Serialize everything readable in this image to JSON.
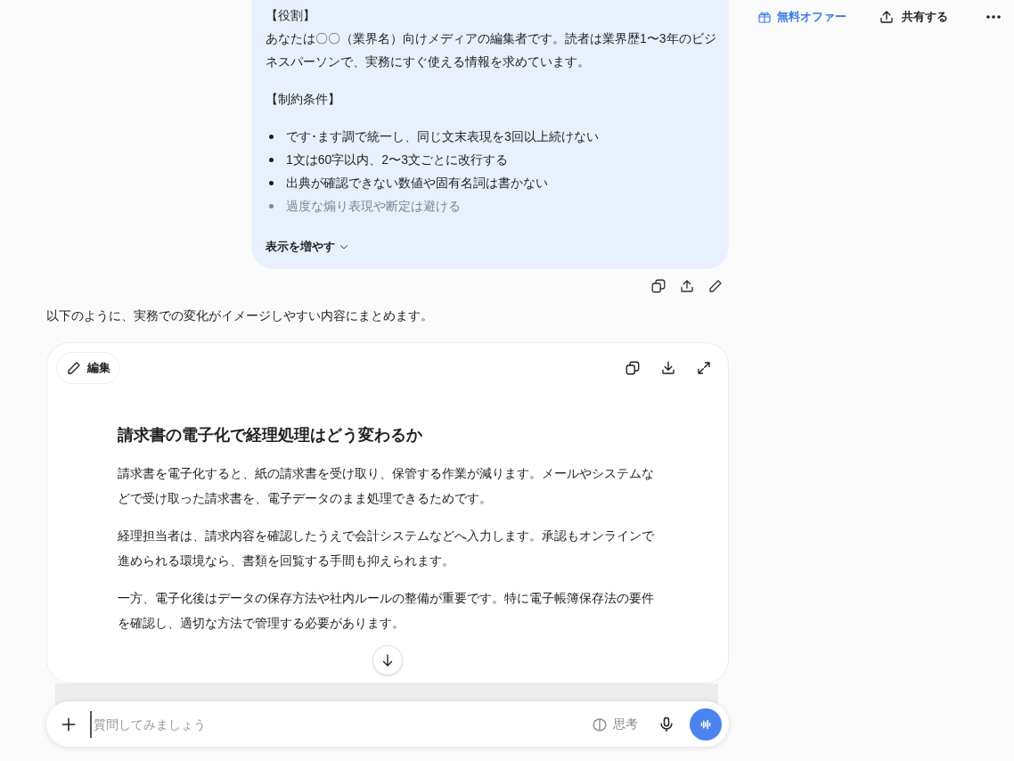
{
  "header": {
    "offer": "無料オファー",
    "share": "共有する"
  },
  "user_message": {
    "role_heading": "【役割】",
    "role_text": "あなたは〇〇（業界名）向けメディアの編集者です。読者は業界歴1〜3年のビジネスパーソンで、実務にすぐ使える情報を求めています。",
    "constraints_heading": "【制約条件】",
    "constraints": [
      {
        "text": "です･ます調で統一し、同じ文末表現を3回以上続けない",
        "faded": false
      },
      {
        "text": "1文は60字以内、2〜3文ごとに改行する",
        "faded": false
      },
      {
        "text": "出典が確認できない数値や固有名詞は書かない",
        "faded": false
      },
      {
        "text": "過度な煽り表現や断定は避ける",
        "faded": true
      }
    ],
    "show_more": "表示を増やす"
  },
  "assistant": {
    "intro": "以下のように、実務での変化がイメージしやすい内容にまとめます。",
    "canvas": {
      "edit_label": "編集",
      "title": "請求書の電子化で経理処理はどう変わるか",
      "paragraphs": [
        "請求書を電子化すると、紙の請求書を受け取り、保管する作業が減ります。メールやシステムなどで受け取った請求書を、電子データのまま処理できるためです。",
        "経理担当者は、請求内容を確認したうえで会計システムなどへ入力します。承認もオンラインで進められる環境なら、書類を回覧する手間も抑えられます。",
        "一方、電子化後はデータの保存方法や社内ルールの整備が重要です。特に電子帳簿保存法の要件を確認し、適切な方法で管理する必要があります。"
      ]
    }
  },
  "composer": {
    "placeholder": "質問してみましょう",
    "think_label": "思考"
  }
}
